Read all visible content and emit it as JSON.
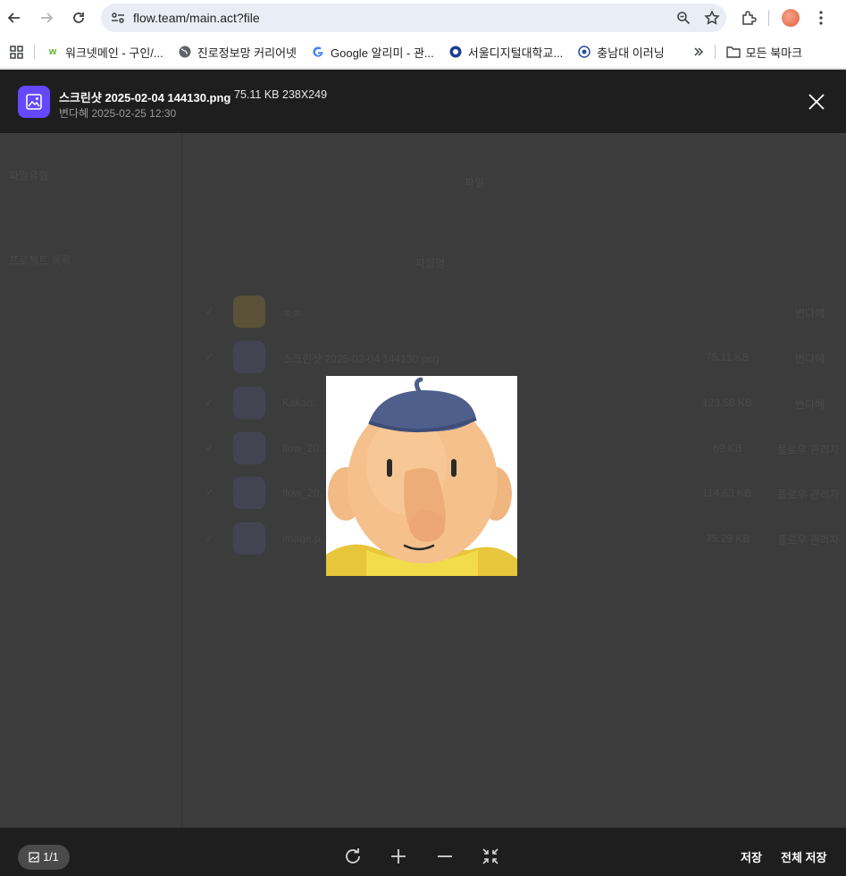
{
  "browser": {
    "url": "flow.team/main.act?file",
    "bookmarks": [
      {
        "label": "워크넷메인 - 구인/...",
        "icon": "worknet-icon"
      },
      {
        "label": "진로정보망 커리어넷",
        "icon": "globe-icon"
      },
      {
        "label": "Google 알리미 - 관...",
        "icon": "google-icon"
      },
      {
        "label": "서울디지털대학교...",
        "icon": "university-icon"
      },
      {
        "label": "충남대 이러닝",
        "icon": "university-icon"
      }
    ],
    "all_bookmarks_label": "모든 북마크"
  },
  "viewer": {
    "file_name": "스크린샷 2025-02-04 144130.png",
    "file_size": "75.11 KB",
    "dimensions": "238X249",
    "owner": "변다혜",
    "date": "2025-02-25 12:30",
    "page_indicator": "1/1",
    "save_label": "저장",
    "save_all_label": "전체 저장"
  },
  "background_app": {
    "side_label": "파일유형",
    "project_label": "프로젝트 목록",
    "tab_active": "파일",
    "column_name": "파일명",
    "rows": [
      {
        "name": "ㅎㅎ",
        "size": "",
        "owner": "변다혜"
      },
      {
        "name": "스크린샷 2025-02-04 144130.png",
        "size": "75.11 KB",
        "owner": "변다혜"
      },
      {
        "name": "Kakao..",
        "size": "123.58 KB",
        "owner": "변다혜"
      },
      {
        "name": "flow_20..",
        "size": "69 KB",
        "owner": "플로우 관리자"
      },
      {
        "name": "flow_20..",
        "size": "114.63 KB",
        "owner": "플로우 관리자"
      },
      {
        "name": "image.p..",
        "size": "75.29 KB",
        "owner": "플로우 관리자"
      }
    ]
  }
}
